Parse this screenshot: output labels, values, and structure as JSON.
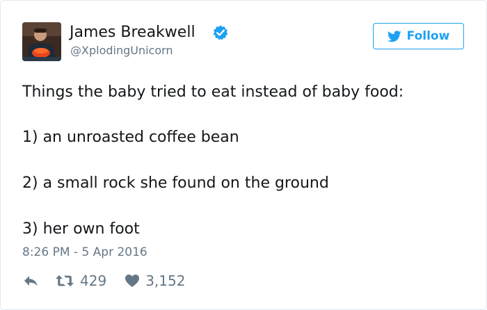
{
  "user": {
    "display_name": "James Breakwell",
    "handle": "@XplodingUnicorn",
    "verified": true,
    "avatar": "profile-photo"
  },
  "follow_button": {
    "label": "Follow",
    "icon": "twitter-bird-icon"
  },
  "tweet": {
    "lines": [
      "Things the baby tried to eat instead of baby food:",
      "1) an unroasted coffee bean",
      "2) a small rock she found on the ground",
      "3) her own foot"
    ],
    "timestamp": "8:26 PM - 5 Apr 2016"
  },
  "actions": {
    "reply_icon": "reply-icon",
    "retweet_icon": "retweet-icon",
    "retweet_count": "429",
    "like_icon": "heart-icon",
    "like_count": "3,152"
  },
  "colors": {
    "accent": "#1da1f2",
    "text": "#14171a",
    "muted": "#657786",
    "border": "#e1e8ed"
  }
}
